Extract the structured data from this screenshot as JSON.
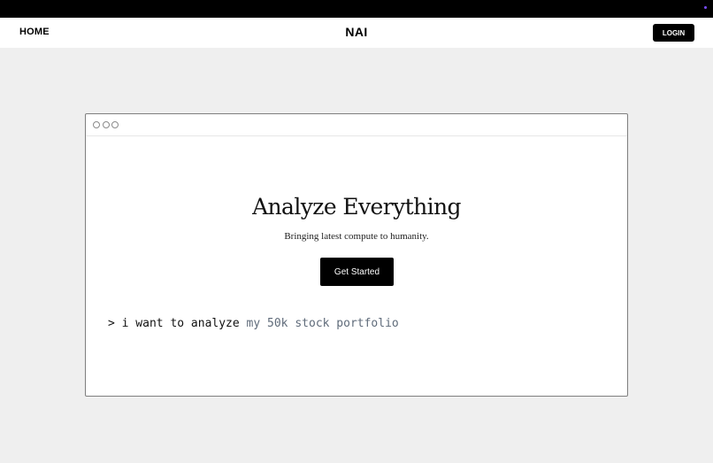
{
  "topbar": {
    "accent_color": "#7a4cff"
  },
  "nav": {
    "home_label": "HOME",
    "brand": "NAI",
    "login_label": "LOGIN"
  },
  "window": {
    "controls": [
      "circle-icon",
      "circle-icon",
      "circle-icon"
    ]
  },
  "hero": {
    "title": "Analyze Everything",
    "subtitle": "Bringing latest compute to humanity.",
    "cta_label": "Get Started"
  },
  "prompt": {
    "typed": "> i want to analyze ",
    "suggestion": "my 50k stock portfolio"
  }
}
